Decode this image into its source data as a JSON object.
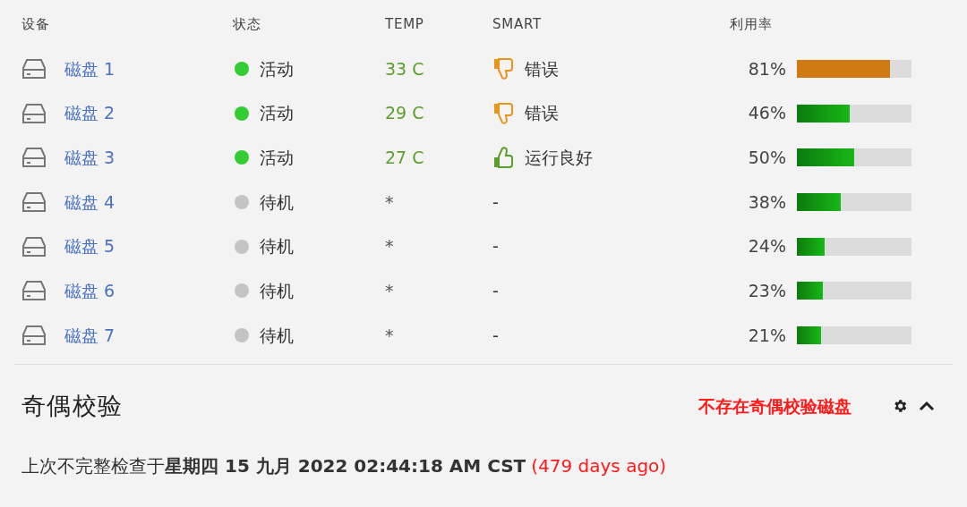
{
  "table": {
    "columns": [
      "设备",
      "状态",
      "TEMP",
      "SMART",
      "利用率"
    ],
    "rows": [
      {
        "device": "磁盘 1",
        "status": {
          "text": "活动",
          "color": "#33cc33"
        },
        "temp": "33 C",
        "smart": {
          "kind": "bad",
          "text": "错误"
        },
        "usage": "81%",
        "level": 0.81,
        "color": "#d07a14"
      },
      {
        "device": "磁盘 2",
        "status": {
          "text": "活动",
          "color": "#33cc33"
        },
        "temp": "29 C",
        "smart": {
          "kind": "bad",
          "text": "错误"
        },
        "usage": "46%",
        "level": 0.46,
        "color": "#17b817"
      },
      {
        "device": "磁盘 3",
        "status": {
          "text": "活动",
          "color": "#33cc33"
        },
        "temp": "27 C",
        "smart": {
          "kind": "good",
          "text": "运行良好"
        },
        "usage": "50%",
        "level": 0.5,
        "color": "#17b817"
      },
      {
        "device": "磁盘 4",
        "status": {
          "text": "待机",
          "color": "#c4c4c4"
        },
        "temp": "*",
        "smart": {
          "kind": "none",
          "text": "-"
        },
        "usage": "38%",
        "level": 0.38,
        "color": "#17b817"
      },
      {
        "device": "磁盘 5",
        "status": {
          "text": "待机",
          "color": "#c4c4c4"
        },
        "temp": "*",
        "smart": {
          "kind": "none",
          "text": "-"
        },
        "usage": "24%",
        "level": 0.24,
        "color": "#17b817"
      },
      {
        "device": "磁盘 6",
        "status": {
          "text": "待机",
          "color": "#c4c4c4"
        },
        "temp": "*",
        "smart": {
          "kind": "none",
          "text": "-"
        },
        "usage": "23%",
        "level": 0.23,
        "color": "#17b817"
      },
      {
        "device": "磁盘 7",
        "status": {
          "text": "待机",
          "color": "#c4c4c4"
        },
        "temp": "*",
        "smart": {
          "kind": "none",
          "text": "-"
        },
        "usage": "21%",
        "level": 0.21,
        "color": "#17b817"
      }
    ]
  },
  "parity": {
    "title": "奇偶校验",
    "warning": "不存在奇偶校验磁盘",
    "expanded": true,
    "last_check": "上次不完整检查于**星期四 15 九月 2022 02:44:18 AM CST**",
    "ago": "(479 days ago)"
  }
}
